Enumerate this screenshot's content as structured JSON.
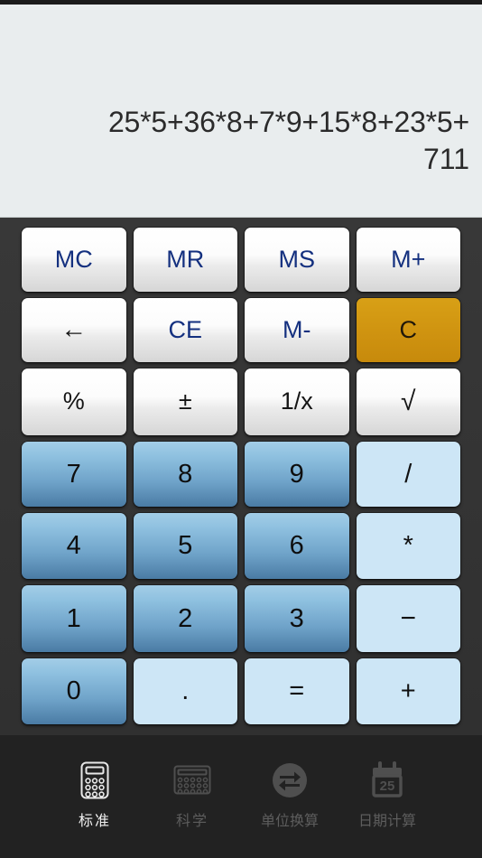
{
  "app": {
    "name": "Calculator",
    "theme": {
      "display_bg": "#e9edee",
      "keypad_bg": "#333333",
      "tabbar_bg": "#222222",
      "memory_text": "#14307f",
      "clear_key_bg": "#cf9310",
      "number_key_top": "#a3cde7",
      "number_key_bottom": "#4a7ba4",
      "operator_key_bg": "#cde6f6",
      "active_tab_text": "#f2f2f2",
      "inactive_tab_text": "#5d5d5d"
    }
  },
  "display": {
    "expression": "25*5+36*8+7*9+15*8+23*5+",
    "result": "711"
  },
  "keypad": {
    "rows": [
      [
        {
          "label": "MC",
          "name": "memory-clear-key",
          "kind": "fn-blue"
        },
        {
          "label": "MR",
          "name": "memory-recall-key",
          "kind": "fn-blue"
        },
        {
          "label": "MS",
          "name": "memory-store-key",
          "kind": "fn-blue"
        },
        {
          "label": "M+",
          "name": "memory-add-key",
          "kind": "fn-blue"
        }
      ],
      [
        {
          "label": "←",
          "name": "backspace-key",
          "kind": "fn-sym"
        },
        {
          "label": "CE",
          "name": "clear-entry-key",
          "kind": "fn-blue"
        },
        {
          "label": "M-",
          "name": "memory-subtract-key",
          "kind": "fn-blue"
        },
        {
          "label": "C",
          "name": "clear-key",
          "kind": "amber"
        }
      ],
      [
        {
          "label": "%",
          "name": "percent-key",
          "kind": "fn-sym"
        },
        {
          "label": "±",
          "name": "sign-toggle-key",
          "kind": "fn-sym"
        },
        {
          "label": "1/x",
          "name": "reciprocal-key",
          "kind": "fn-sym"
        },
        {
          "label": "√",
          "name": "square-root-key",
          "kind": "fn-sym"
        }
      ],
      [
        {
          "label": "7",
          "name": "digit-7-key",
          "kind": "num"
        },
        {
          "label": "8",
          "name": "digit-8-key",
          "kind": "num"
        },
        {
          "label": "9",
          "name": "digit-9-key",
          "kind": "num"
        },
        {
          "label": "/",
          "name": "divide-key",
          "kind": "op"
        }
      ],
      [
        {
          "label": "4",
          "name": "digit-4-key",
          "kind": "num"
        },
        {
          "label": "5",
          "name": "digit-5-key",
          "kind": "num"
        },
        {
          "label": "6",
          "name": "digit-6-key",
          "kind": "num"
        },
        {
          "label": "*",
          "name": "multiply-key",
          "kind": "op"
        }
      ],
      [
        {
          "label": "1",
          "name": "digit-1-key",
          "kind": "num"
        },
        {
          "label": "2",
          "name": "digit-2-key",
          "kind": "num"
        },
        {
          "label": "3",
          "name": "digit-3-key",
          "kind": "num"
        },
        {
          "label": "−",
          "name": "subtract-key",
          "kind": "op"
        }
      ],
      [
        {
          "label": "0",
          "name": "digit-0-key",
          "kind": "num"
        },
        {
          "label": ".",
          "name": "decimal-point-key",
          "kind": "op"
        },
        {
          "label": "=",
          "name": "equals-key",
          "kind": "op"
        },
        {
          "label": "+",
          "name": "add-key",
          "kind": "op"
        }
      ]
    ]
  },
  "tabbar": {
    "tabs": [
      {
        "label": "标准",
        "name": "tab-standard",
        "icon": "calculator-tall-icon",
        "active": true
      },
      {
        "label": "科学",
        "name": "tab-scientific",
        "icon": "calculator-wide-icon",
        "active": false
      },
      {
        "label": "单位换算",
        "name": "tab-unit-conversion",
        "icon": "swap-arrows-icon",
        "active": false
      },
      {
        "label": "日期计算",
        "name": "tab-date-calculation",
        "icon": "calendar-25-icon",
        "active": false
      }
    ]
  }
}
